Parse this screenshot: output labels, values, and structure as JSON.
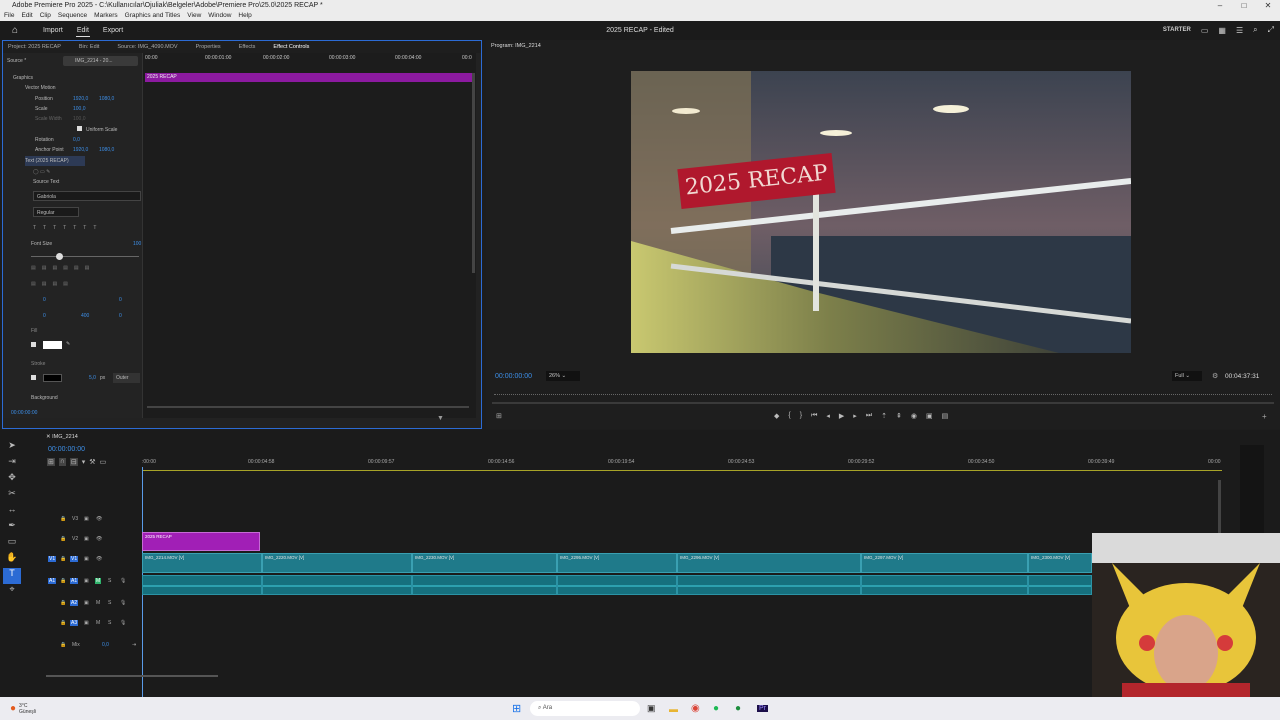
{
  "window": {
    "title": "Adobe Premiere Pro 2025 - C:\\Kullanıcılar\\Ojuliak\\Belgeler\\Adobe\\Premiere Pro\\25.0\\2025 RECAP *"
  },
  "menu": [
    "File",
    "Edit",
    "Clip",
    "Sequence",
    "Markers",
    "Graphics and Titles",
    "View",
    "Window",
    "Help"
  ],
  "workspace": {
    "tabs": [
      "Import",
      "Edit",
      "Export"
    ],
    "active_tab": "Edit",
    "doc_title": "2025 RECAP - Edited",
    "starter": "STARTER"
  },
  "left_panel": {
    "tabs": [
      "Project: 2025 RECAP",
      "Bin: Edit",
      "Source: IMG_4090.MOV",
      "Properties",
      "Effects",
      "Effect Controls"
    ],
    "active_tab": "Effect Controls",
    "source_label": "Source *",
    "clip_label": "IMG_2214 - 20...",
    "section_graphics": "Graphics",
    "vector_motion": "Vector Motion",
    "position_label": "Position",
    "position_x": "1920,0",
    "position_y": "1080,0",
    "scale_label": "Scale",
    "scale_value": "100,0",
    "scale_width_label": "Scale Width",
    "scale_width_value": "100,0",
    "uniform_scale": "Uniform Scale",
    "rotation_label": "Rotation",
    "rotation_value": "0,0",
    "anchor_label": "Anchor Point",
    "anchor_x": "1920,0",
    "anchor_y": "1080,0",
    "text_layer": "Text (2025 RECAP)",
    "source_text": "Source Text",
    "font_name": "Gabriola",
    "font_style": "Regular",
    "font_size_label": "Font Size",
    "font_size_value": "100",
    "tracking_value": "0",
    "leading_value": "0",
    "kerning_value": "0",
    "tsume_value": "400",
    "baseline_value": "0",
    "fill_label": "Fill",
    "stroke_label": "Stroke",
    "stroke_width": "5,0",
    "stroke_unit": "px",
    "stroke_type": "Outer",
    "background_label": "Background",
    "timecode": "00:00:00:00",
    "ruler": [
      "00:00",
      "00:00:01:00",
      "00:00:02:00",
      "00:00:03:00",
      "00:00:04:00",
      "00:0"
    ],
    "clip_bar_label": "2025 RECAP"
  },
  "program": {
    "title": "Program: IMG_2214",
    "overlay_text": "2025 RECAP",
    "timecode": "00:00:00:00",
    "zoom": "26%",
    "resolution": "Full",
    "duration": "00:04:37:31"
  },
  "timeline": {
    "sequence": "IMG_2214",
    "timecode": "00:00:00:00",
    "ruler": [
      ":00:00",
      "00:00:04:58",
      "00:00:09:57",
      "00:00:14:56",
      "00:00:19:54",
      "00:00:24:53",
      "00:00:29:52",
      "00:00:34:50",
      "00:00:39:49",
      "00:00"
    ],
    "tracks": [
      {
        "id": "V3"
      },
      {
        "id": "V2"
      },
      {
        "id": "V1",
        "src": "V1"
      },
      {
        "id": "A1",
        "src": "A1"
      },
      {
        "id": "A2"
      },
      {
        "id": "A3"
      }
    ],
    "mix_label": "Mix",
    "mix_value": "0,0",
    "title_clip": "2025 RECAP",
    "video_clips": [
      "IMG_2214.MOV [V]",
      "IMG_2220.MOV [V]",
      "IMG_2230.MOV [V]",
      "IMG_2295.MOV [V]",
      "IMG_2296.MOV [V]",
      "IMG_2297.MOV [V]",
      "IMG_2300.MOV [V]"
    ],
    "track_toggle_m": "M",
    "track_toggle_s": "S"
  },
  "taskbar": {
    "weather_temp": "3°C",
    "weather_desc": "Güneşli",
    "search_label": "Ara"
  }
}
